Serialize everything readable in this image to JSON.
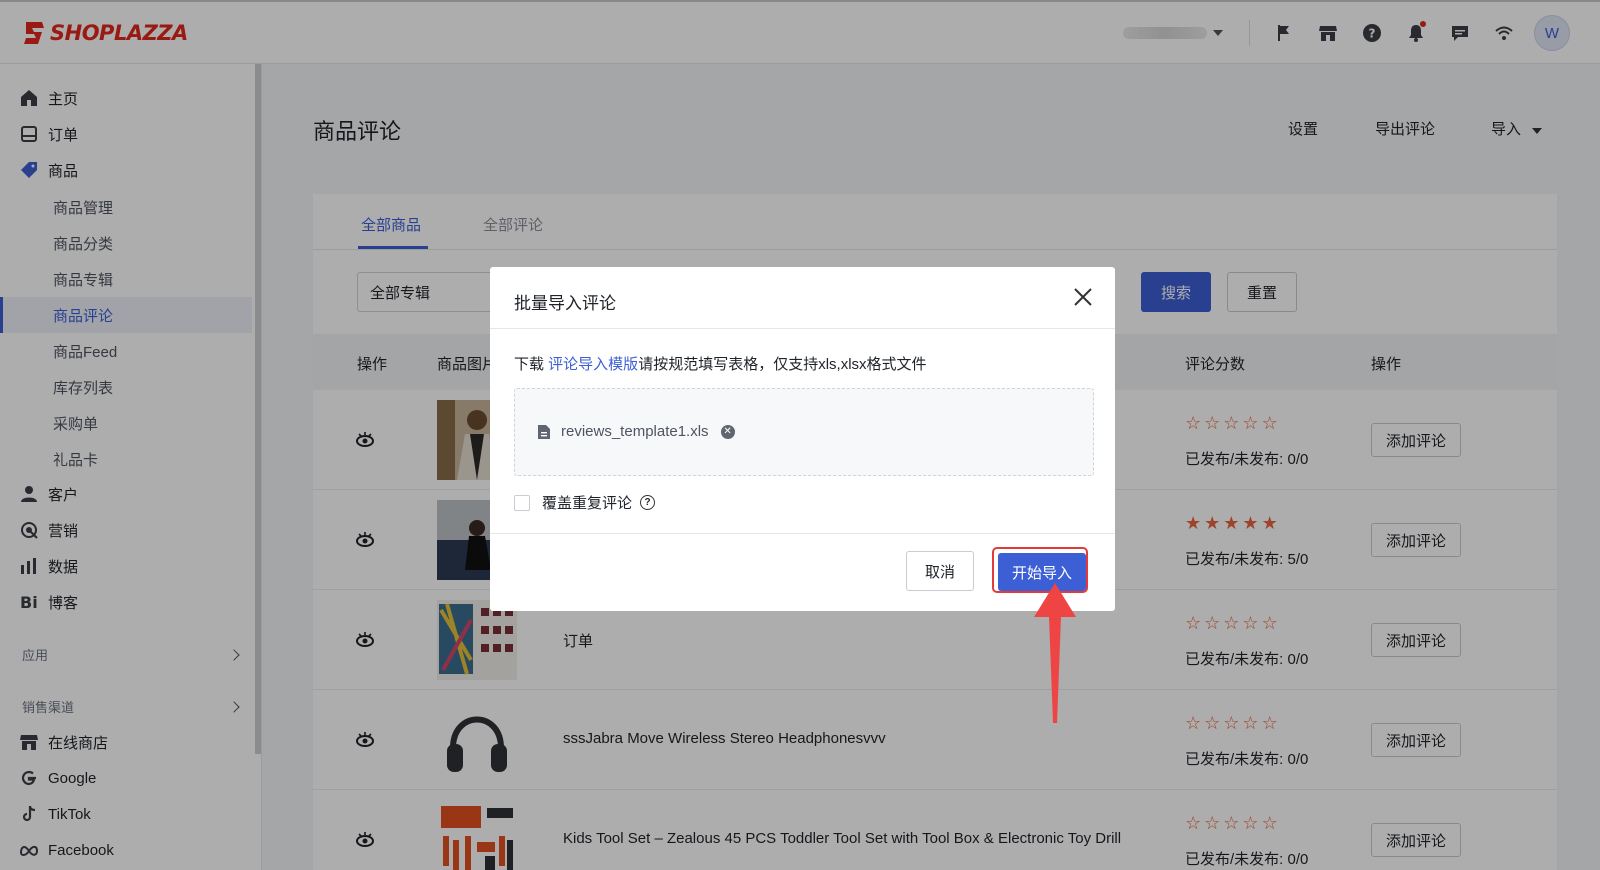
{
  "brand": {
    "logo_text": "SHOPLAZZA",
    "accent": "#3d5fd6",
    "brand_red": "#e2261d"
  },
  "topbar": {
    "icons": [
      "flag-icon",
      "store-icon",
      "help-icon",
      "bell-icon",
      "message-icon",
      "wifi-icon"
    ],
    "avatar": "W"
  },
  "sidebar": {
    "items": [
      {
        "label": "主页",
        "icon": "home-icon"
      },
      {
        "label": "订单",
        "icon": "inbox-icon"
      },
      {
        "label": "商品",
        "icon": "tag-icon"
      },
      {
        "label": "客户",
        "icon": "user-icon"
      },
      {
        "label": "营销",
        "icon": "marketing-icon"
      },
      {
        "label": "数据",
        "icon": "bar-chart-icon"
      },
      {
        "label": "博客",
        "icon": "blog-icon"
      }
    ],
    "sub_items": [
      "商品管理",
      "商品分类",
      "商品专辑",
      "商品评论",
      "商品Feed",
      "库存列表",
      "采购单",
      "礼品卡"
    ],
    "groups": {
      "apps": "应用",
      "channels": "销售渠道"
    },
    "channels": [
      {
        "label": "在线商店",
        "icon": "store-icon"
      },
      {
        "label": "Google",
        "icon": "google-icon"
      },
      {
        "label": "TikTok",
        "icon": "tiktok-icon"
      },
      {
        "label": "Facebook",
        "icon": "meta-icon"
      }
    ]
  },
  "page": {
    "title": "商品评论",
    "actions": {
      "settings": "设置",
      "export": "导出评论",
      "import": "导入"
    }
  },
  "tabs": {
    "all_products": "全部商品",
    "all_reviews": "全部评论"
  },
  "filters": {
    "collection": "全部专辑",
    "search": "搜索",
    "reset": "重置"
  },
  "table": {
    "headers": {
      "op": "操作",
      "image": "商品图片",
      "score": "评论分数",
      "actions": "操作"
    },
    "add_review": "添加评论",
    "rows": [
      {
        "name": "",
        "rating": 0,
        "status": "已发布/未发布: 0/0"
      },
      {
        "name": "",
        "rating": 5,
        "status": "已发布/未发布: 5/0"
      },
      {
        "name": "订单",
        "rating": 0,
        "status": "已发布/未发布: 0/0"
      },
      {
        "name": "sssJabra Move Wireless Stereo Headphonesvvv",
        "rating": 0,
        "status": "已发布/未发布: 0/0"
      },
      {
        "name": "Kids Tool Set – Zealous 45 PCS Toddler Tool Set with Tool Box & Electronic Toy Drill",
        "rating": 0,
        "status": "已发布/未发布: 0/0"
      }
    ]
  },
  "modal": {
    "title": "批量导入评论",
    "desc_prefix": "下载 ",
    "desc_link": "评论导入模版",
    "desc_suffix": "请按规范填写表格，仅支持xls,xlsx格式文件",
    "file_name": "reviews_template1.xls",
    "overwrite_label": "覆盖重复评论",
    "cancel": "取消",
    "start": "开始导入"
  }
}
